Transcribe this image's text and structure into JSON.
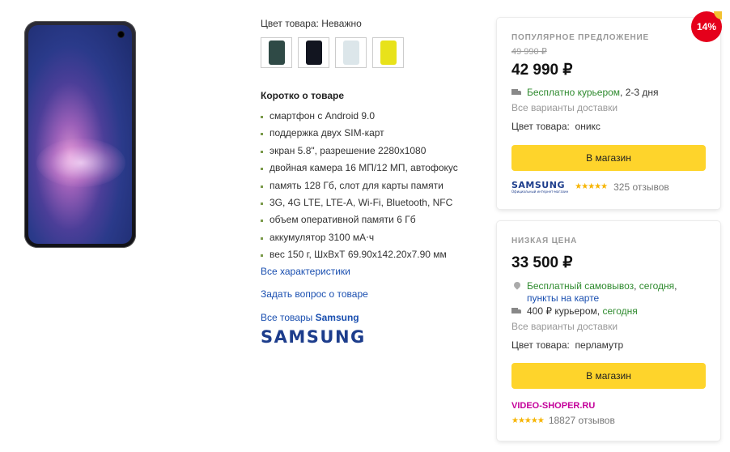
{
  "product": {
    "color_label": "Цвет товара:",
    "color_value": "Неважно",
    "swatch_colors": [
      "#2f4a46",
      "#121520",
      "#dce6ea",
      "#e8e21a"
    ],
    "short_title": "Коротко о товаре",
    "features": [
      "смартфон с Android 9.0",
      "поддержка двух SIM-карт",
      "экран 5.8\", разрешение 2280x1080",
      "двойная камера 16 МП/12 МП, автофокус",
      "память 128 Гб, слот для карты памяти",
      "3G, 4G LTE, LTE-A, Wi-Fi, Bluetooth, NFC",
      "объем оперативной памяти 6 Гб",
      "аккумулятор 3100 мА⋅ч",
      "вес 150 г, ШxВxТ 69.90x142.20x7.90 мм"
    ],
    "all_characteristics": "Все характеристики",
    "ask_question": "Задать вопрос о товаре",
    "all_goods_prefix": "Все товары",
    "all_goods_brand": "Samsung",
    "brand_logo": "SAMSUNG"
  },
  "offers": [
    {
      "kicker": "Популярное предложение",
      "old_price": "49 990 ₽",
      "price": "42 990 ₽",
      "discount_badge": "14%",
      "delivery_link": "Бесплатно курьером",
      "delivery_days": ", 2-3 дня",
      "all_delivery": "Все варианты доставки",
      "color_label": "Цвет товара:",
      "color_value": "оникс",
      "button": "В магазин",
      "seller": "SAMSUNG",
      "seller_sub": "Официальный интернет-магазин",
      "stars": "★★★★★",
      "reviews": "325 отзывов"
    },
    {
      "kicker": "Низкая цена",
      "price": "33 500 ₽",
      "pickup_link": "Бесплатный самовывоз",
      "pickup_sep": ", ",
      "pickup_day": "сегодня",
      "pickup_comma": ",",
      "points_link": "пункты на карте",
      "courier_price": "400 ₽ курьером",
      "courier_sep": ", ",
      "courier_day": "сегодня",
      "all_delivery": "Все варианты доставки",
      "color_label": "Цвет товара:",
      "color_value": "перламутр",
      "button": "В магазин",
      "seller": "VIDEO-SHOPER.RU",
      "stars": "★★★★★",
      "reviews": "18827 отзывов"
    }
  ]
}
